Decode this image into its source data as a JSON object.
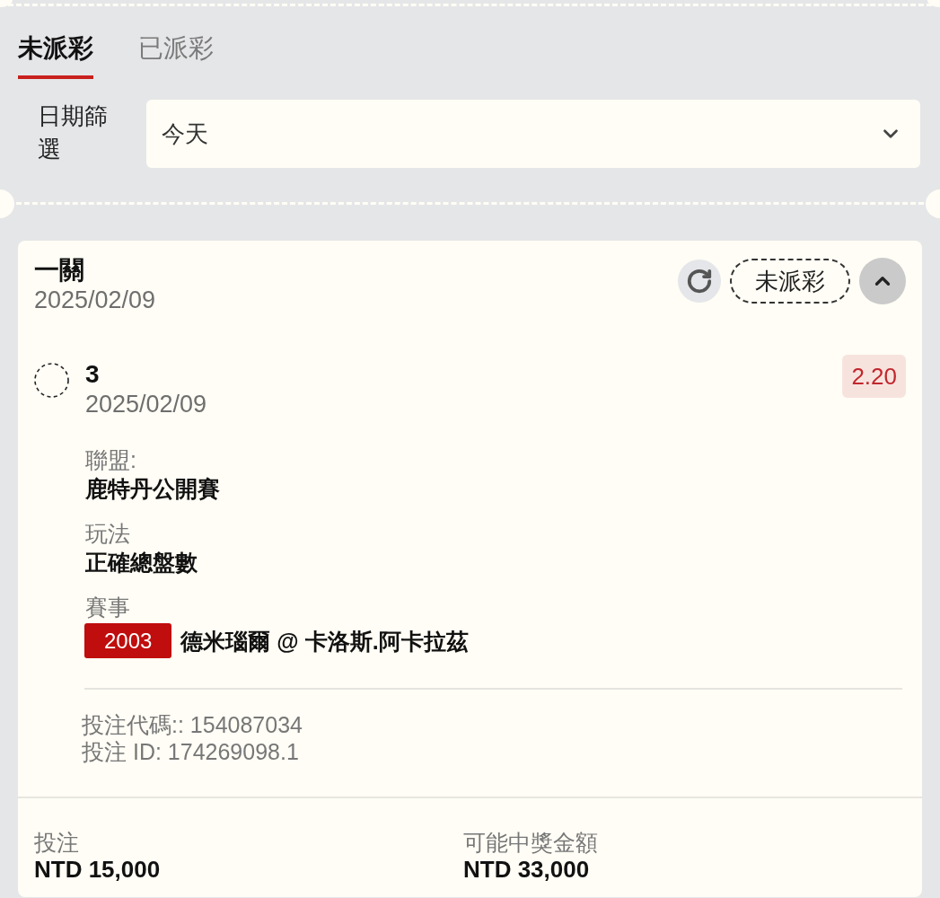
{
  "tabs": [
    {
      "label": "未派彩",
      "selected": true
    },
    {
      "label": "已派彩",
      "selected": false
    }
  ],
  "date_filter": {
    "label": "日期篩選",
    "value": "今天"
  },
  "bet_card": {
    "title": "一關",
    "date": "2025/02/09",
    "status": "未派彩",
    "expanded": true,
    "selections": [
      {
        "name": "3",
        "date": "2025/02/09",
        "odds": "2.20",
        "fields": [
          {
            "label": "聯盟:",
            "value": "鹿特丹公開賽"
          },
          {
            "label": "玩法",
            "value": "正確總盤數"
          },
          {
            "label": "賽事",
            "tag": "2003",
            "value": "德米瑙爾 @ 卡洛斯.阿卡拉茲"
          }
        ],
        "codes": [
          "投注代碼:: 154087034",
          "投注 ID: 174269098.1"
        ]
      }
    ],
    "summary": [
      {
        "label": "投注",
        "value": "NTD 15,000"
      },
      {
        "label": "可能中獎金額",
        "value": "NTD 33,000"
      }
    ]
  }
}
